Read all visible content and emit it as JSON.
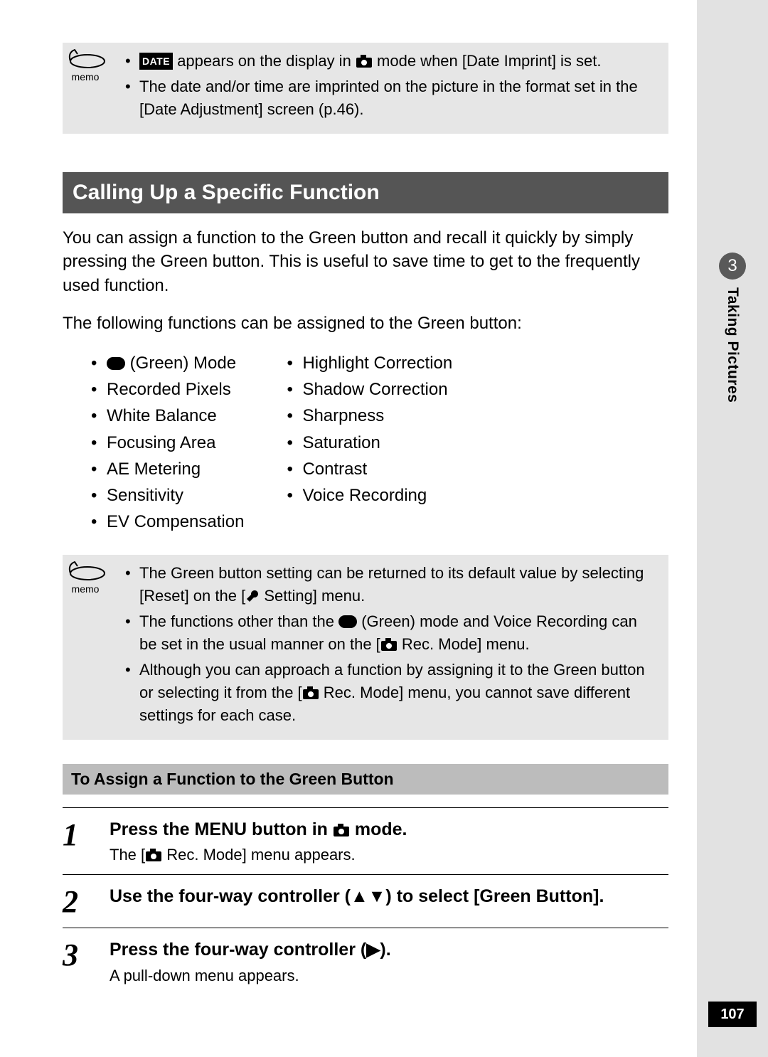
{
  "side_tab": {
    "num": "3",
    "label": "Taking Pictures"
  },
  "page_number": "107",
  "memo_top": {
    "line1_pre": "",
    "line1_badge": "DATE",
    "line1_mid": " appears on the display in ",
    "line1_post": " mode when [Date Imprint] is set.",
    "line2": "The date and/or time are imprinted on the picture in the format set in the [Date Adjustment] screen (p.46)."
  },
  "heading": "Calling Up a Specific Function",
  "intro1": "You can assign a function to the Green button and recall it quickly by simply pressing the Green button. This is useful to save time to get to the frequently used function.",
  "intro2": "The following functions can be assigned to the Green button:",
  "funcs_left": [
    "(Green) Mode",
    "Recorded Pixels",
    "White Balance",
    "Focusing Area",
    "AE Metering",
    "Sensitivity",
    "EV Compensation"
  ],
  "funcs_right": [
    "Highlight Correction",
    "Shadow Correction",
    "Sharpness",
    "Saturation",
    "Contrast",
    "Voice Recording"
  ],
  "memo_mid": {
    "b1_pre": "The Green button setting can be returned to its default value by selecting [Reset] on the [",
    "b1_post": " Setting] menu.",
    "b2_pre": "The functions other than the ",
    "b2_mid": " (Green) mode and Voice Recording can be set in the usual manner on the [",
    "b2_post": " Rec. Mode] menu.",
    "b3_pre": "Although you can approach a function by assigning it to the Green button or selecting it from the [",
    "b3_post": " Rec. Mode] menu, you cannot save different settings for each case."
  },
  "subhead": "To Assign a Function to the Green Button",
  "steps": {
    "s1_num": "1",
    "s1_title_pre": "Press the MENU button in ",
    "s1_title_post": " mode.",
    "s1_desc_pre": "The [",
    "s1_desc_post": " Rec. Mode] menu appears.",
    "s2_num": "2",
    "s2_title": "Use the four-way controller (▲▼) to select [Green Button].",
    "s3_num": "3",
    "s3_title": "Press the four-way controller (▶).",
    "s3_desc": "A pull-down menu appears."
  },
  "memo_label": "memo"
}
